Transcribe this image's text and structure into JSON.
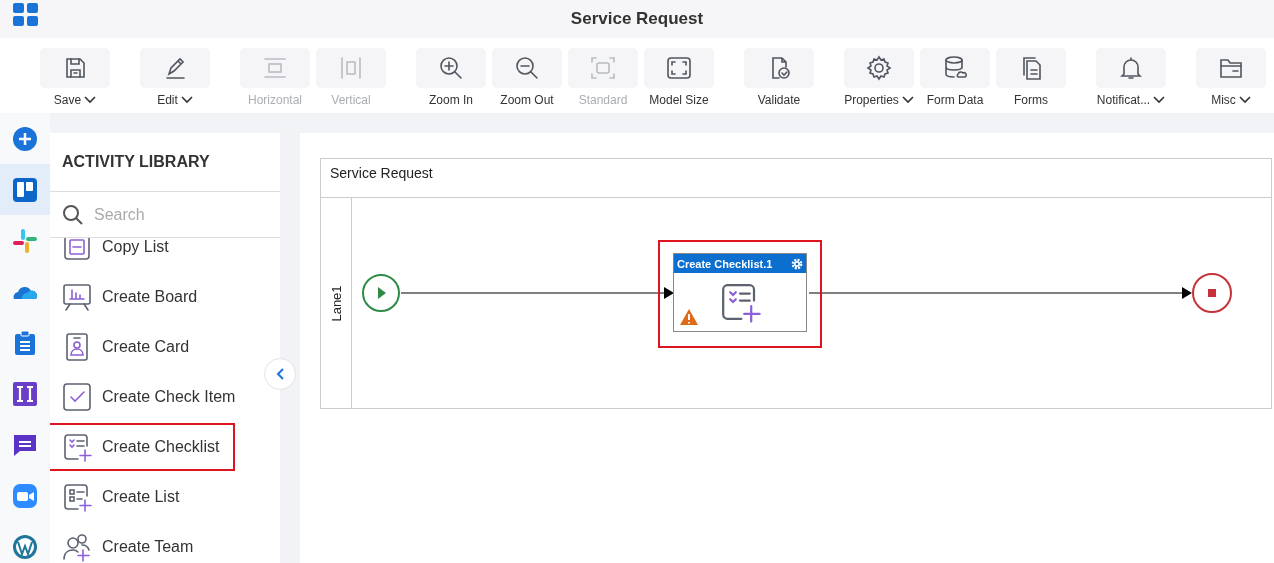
{
  "window": {
    "title": "Service Request"
  },
  "toolbar": [
    [
      {
        "label": "Save",
        "kind": "save",
        "disabled": false,
        "dropdown": true
      }
    ],
    [
      {
        "label": "Edit",
        "kind": "edit",
        "disabled": false,
        "dropdown": true
      }
    ],
    [
      {
        "label": "Horizontal",
        "kind": "horizontal",
        "disabled": true,
        "dropdown": false
      },
      {
        "label": "Vertical",
        "kind": "vertical",
        "disabled": true,
        "dropdown": false
      }
    ],
    [
      {
        "label": "Zoom In",
        "kind": "zoomin",
        "disabled": false,
        "dropdown": false
      },
      {
        "label": "Zoom Out",
        "kind": "zoomout",
        "disabled": false,
        "dropdown": false
      },
      {
        "label": "Standard",
        "kind": "standard",
        "disabled": true,
        "dropdown": false
      },
      {
        "label": "Model Size",
        "kind": "modelsize",
        "disabled": false,
        "dropdown": false
      }
    ],
    [
      {
        "label": "Validate",
        "kind": "validate",
        "disabled": false,
        "dropdown": false
      }
    ],
    [
      {
        "label": "Properties",
        "kind": "gear",
        "disabled": false,
        "dropdown": true
      },
      {
        "label": "Form Data",
        "kind": "database",
        "disabled": false,
        "dropdown": false
      },
      {
        "label": "Forms",
        "kind": "forms",
        "disabled": false,
        "dropdown": false
      }
    ],
    [
      {
        "label": "Notificat...",
        "kind": "bell",
        "disabled": false,
        "dropdown": true
      }
    ],
    [
      {
        "label": "Misc",
        "kind": "folder",
        "disabled": false,
        "dropdown": true
      }
    ]
  ],
  "rail": [
    {
      "kind": "plus",
      "selected": false
    },
    {
      "kind": "board",
      "selected": true
    },
    {
      "kind": "slack",
      "selected": false
    },
    {
      "kind": "cloud",
      "selected": false
    },
    {
      "kind": "clipboard",
      "selected": false
    },
    {
      "kind": "pillars",
      "selected": false
    },
    {
      "kind": "chat",
      "selected": false
    },
    {
      "kind": "video",
      "selected": false
    },
    {
      "kind": "globe",
      "selected": false
    }
  ],
  "library": {
    "title": "ACTIVITY LIBRARY",
    "search": {
      "placeholder": "Search"
    },
    "items": [
      {
        "label": "Copy List",
        "kind": "copy",
        "highlighted": false
      },
      {
        "label": "Create Board",
        "kind": "board",
        "highlighted": false
      },
      {
        "label": "Create Card",
        "kind": "card",
        "highlighted": false
      },
      {
        "label": "Create Check Item",
        "kind": "check",
        "highlighted": false
      },
      {
        "label": "Create Checklist",
        "kind": "checklist",
        "highlighted": true
      },
      {
        "label": "Create List",
        "kind": "list",
        "highlighted": false
      },
      {
        "label": "Create Team",
        "kind": "team",
        "highlighted": false
      }
    ]
  },
  "canvas": {
    "pool": {
      "title": "Service Request",
      "lane": "Lane1"
    },
    "activity": {
      "title": "Create Checklist.1",
      "highlighted": true,
      "warning": true
    }
  }
}
